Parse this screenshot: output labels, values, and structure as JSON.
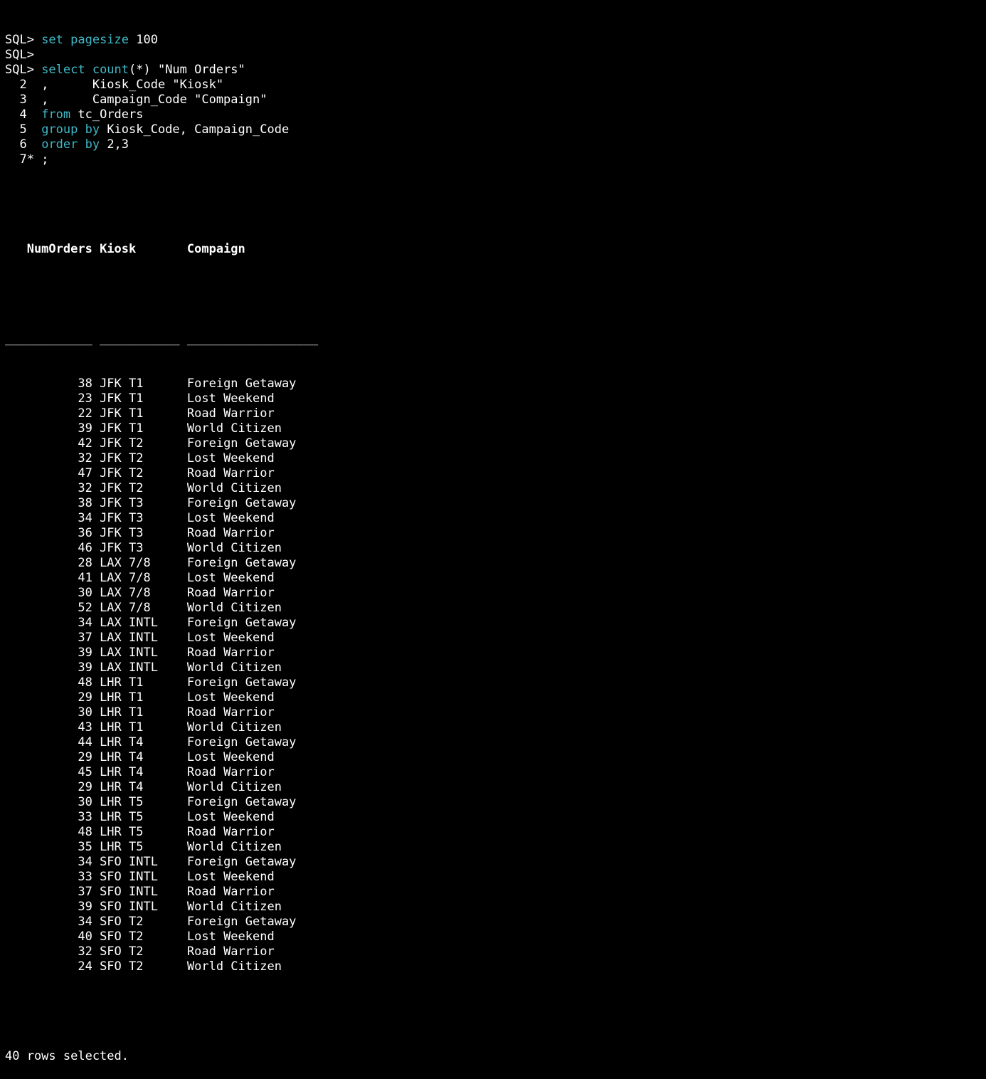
{
  "prompt": "SQL>",
  "commands": [
    {
      "kind": "prompt",
      "prefix": "SQL> ",
      "parts": [
        {
          "t": "set pagesize",
          "kw": true
        },
        {
          "t": " 100",
          "kw": false
        }
      ]
    },
    {
      "kind": "prompt",
      "prefix": "SQL>",
      "parts": []
    },
    {
      "kind": "prompt",
      "prefix": "SQL> ",
      "parts": [
        {
          "t": "select count",
          "kw": true
        },
        {
          "t": "(*) \"Num Orders\"",
          "kw": false
        }
      ]
    },
    {
      "kind": "cont",
      "prefix": "  2  ",
      "parts": [
        {
          "t": ",      Kiosk_Code \"Kiosk\"",
          "kw": false
        }
      ]
    },
    {
      "kind": "cont",
      "prefix": "  3  ",
      "parts": [
        {
          "t": ",      Campaign_Code \"Compaign\"",
          "kw": false
        }
      ]
    },
    {
      "kind": "cont",
      "prefix": "  4  ",
      "parts": [
        {
          "t": "from",
          "kw": true
        },
        {
          "t": " tc_Orders",
          "kw": false
        }
      ]
    },
    {
      "kind": "cont",
      "prefix": "  5  ",
      "parts": [
        {
          "t": "group by",
          "kw": true
        },
        {
          "t": " Kiosk_Code, Campaign_Code",
          "kw": false
        }
      ]
    },
    {
      "kind": "cont",
      "prefix": "  6  ",
      "parts": [
        {
          "t": "order by",
          "kw": true
        },
        {
          "t": " 2,3",
          "kw": false
        }
      ]
    },
    {
      "kind": "cont",
      "prefix": "  7* ",
      "parts": [
        {
          "t": ";",
          "kw": false
        }
      ]
    }
  ],
  "table": {
    "headers": [
      "NumOrders",
      "Kiosk",
      "Compaign"
    ],
    "widths": [
      12,
      11,
      18
    ],
    "rows": [
      [
        "38",
        "JFK T1",
        "Foreign Getaway"
      ],
      [
        "23",
        "JFK T1",
        "Lost Weekend"
      ],
      [
        "22",
        "JFK T1",
        "Road Warrior"
      ],
      [
        "39",
        "JFK T1",
        "World Citizen"
      ],
      [
        "42",
        "JFK T2",
        "Foreign Getaway"
      ],
      [
        "32",
        "JFK T2",
        "Lost Weekend"
      ],
      [
        "47",
        "JFK T2",
        "Road Warrior"
      ],
      [
        "32",
        "JFK T2",
        "World Citizen"
      ],
      [
        "38",
        "JFK T3",
        "Foreign Getaway"
      ],
      [
        "34",
        "JFK T3",
        "Lost Weekend"
      ],
      [
        "36",
        "JFK T3",
        "Road Warrior"
      ],
      [
        "46",
        "JFK T3",
        "World Citizen"
      ],
      [
        "28",
        "LAX 7/8",
        "Foreign Getaway"
      ],
      [
        "41",
        "LAX 7/8",
        "Lost Weekend"
      ],
      [
        "30",
        "LAX 7/8",
        "Road Warrior"
      ],
      [
        "52",
        "LAX 7/8",
        "World Citizen"
      ],
      [
        "34",
        "LAX INTL",
        "Foreign Getaway"
      ],
      [
        "37",
        "LAX INTL",
        "Lost Weekend"
      ],
      [
        "39",
        "LAX INTL",
        "Road Warrior"
      ],
      [
        "39",
        "LAX INTL",
        "World Citizen"
      ],
      [
        "48",
        "LHR T1",
        "Foreign Getaway"
      ],
      [
        "29",
        "LHR T1",
        "Lost Weekend"
      ],
      [
        "30",
        "LHR T1",
        "Road Warrior"
      ],
      [
        "43",
        "LHR T1",
        "World Citizen"
      ],
      [
        "44",
        "LHR T4",
        "Foreign Getaway"
      ],
      [
        "29",
        "LHR T4",
        "Lost Weekend"
      ],
      [
        "45",
        "LHR T4",
        "Road Warrior"
      ],
      [
        "29",
        "LHR T4",
        "World Citizen"
      ],
      [
        "30",
        "LHR T5",
        "Foreign Getaway"
      ],
      [
        "33",
        "LHR T5",
        "Lost Weekend"
      ],
      [
        "48",
        "LHR T5",
        "Road Warrior"
      ],
      [
        "35",
        "LHR T5",
        "World Citizen"
      ],
      [
        "34",
        "SFO INTL",
        "Foreign Getaway"
      ],
      [
        "33",
        "SFO INTL",
        "Lost Weekend"
      ],
      [
        "37",
        "SFO INTL",
        "Road Warrior"
      ],
      [
        "39",
        "SFO INTL",
        "World Citizen"
      ],
      [
        "34",
        "SFO T2",
        "Foreign Getaway"
      ],
      [
        "40",
        "SFO T2",
        "Lost Weekend"
      ],
      [
        "32",
        "SFO T2",
        "Road Warrior"
      ],
      [
        "24",
        "SFO T2",
        "World Citizen"
      ]
    ]
  },
  "footer": "40 rows selected.",
  "colors": {
    "background": "#000000",
    "text": "#ffffff",
    "keyword": "#3fb8c6"
  }
}
